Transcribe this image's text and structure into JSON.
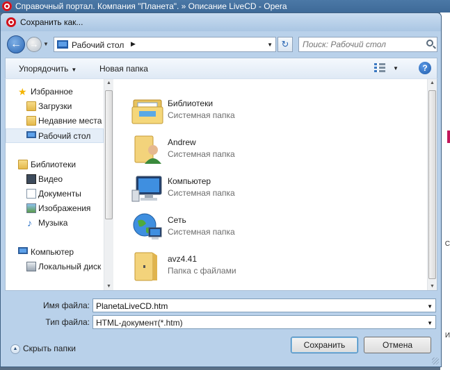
{
  "background_window": {
    "title": "Справочный портал. Компания \"Планета\". » Описание LiveCD - Opera"
  },
  "dialog": {
    "title": "Сохранить как..."
  },
  "navigation": {
    "address_location": "Рабочий стол",
    "search_placeholder": "Поиск: Рабочий стол"
  },
  "toolbar": {
    "organize_label": "Упорядочить",
    "new_folder_label": "Новая папка"
  },
  "sidebar": {
    "items": [
      {
        "label": "Избранное",
        "icon": "star-icon"
      },
      {
        "label": "Загрузки",
        "icon": "downloads-folder-icon"
      },
      {
        "label": "Недавние места",
        "icon": "recent-places-icon"
      },
      {
        "label": "Рабочий стол",
        "icon": "desktop-icon",
        "selected": true
      },
      {
        "label": "Библиотеки",
        "icon": "libraries-icon"
      },
      {
        "label": "Видео",
        "icon": "video-icon"
      },
      {
        "label": "Документы",
        "icon": "documents-icon"
      },
      {
        "label": "Изображения",
        "icon": "pictures-icon"
      },
      {
        "label": "Музыка",
        "icon": "music-icon"
      },
      {
        "label": "Компьютер",
        "icon": "computer-icon"
      },
      {
        "label": "Локальный диск",
        "icon": "local-disk-icon"
      }
    ]
  },
  "files": [
    {
      "name": "Библиотеки",
      "type": "Системная папка",
      "icon": "libraries-folder-icon"
    },
    {
      "name": "Andrew",
      "type": "Системная папка",
      "icon": "user-folder-icon"
    },
    {
      "name": "Компьютер",
      "type": "Системная папка",
      "icon": "computer-icon"
    },
    {
      "name": "Сеть",
      "type": "Системная папка",
      "icon": "network-icon"
    },
    {
      "name": "avz4.41",
      "type": "Папка с файлами",
      "icon": "folder-icon"
    }
  ],
  "fields": {
    "filename_label": "Имя файла:",
    "filename_value": "PlanetaLiveCD.htm",
    "filetype_label": "Тип файла:",
    "filetype_value": "HTML-документ(*.htm)"
  },
  "footer": {
    "hide_folders_label": "Скрыть папки",
    "save_label": "Сохранить",
    "cancel_label": "Отмена"
  }
}
